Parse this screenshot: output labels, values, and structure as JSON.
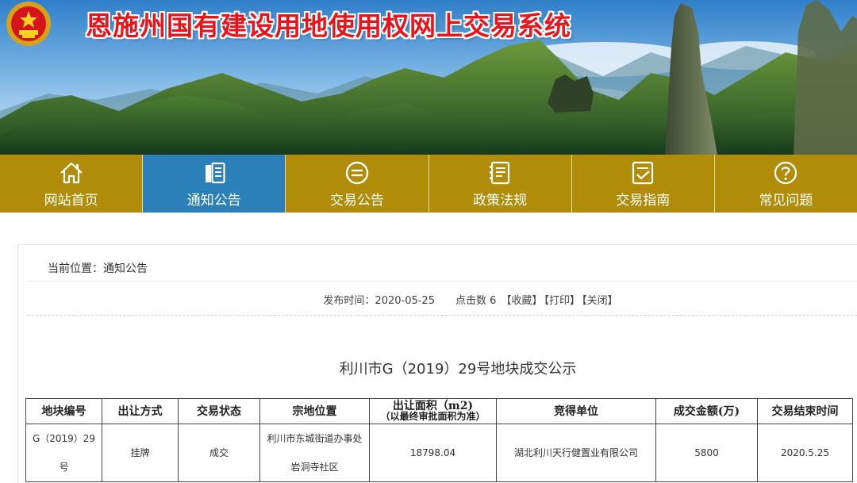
{
  "header": {
    "site_title": "恩施州国有建设用地使用权网上交易系统",
    "title_color": "#e8131b"
  },
  "nav": {
    "items": [
      {
        "label": "网站首页",
        "icon": "home-icon",
        "active": false
      },
      {
        "label": "通知公告",
        "icon": "notice-book-icon",
        "active": true
      },
      {
        "label": "交易公告",
        "icon": "trade-circle-icon",
        "active": false
      },
      {
        "label": "政策法规",
        "icon": "policy-book-icon",
        "active": false
      },
      {
        "label": "交易指南",
        "icon": "guide-check-icon",
        "active": false
      },
      {
        "label": "常见问题",
        "icon": "question-icon",
        "active": false
      }
    ],
    "bg_color": "#b08c09",
    "active_color": "#2b80b9"
  },
  "breadcrumb": {
    "text": "当前位置：通知公告"
  },
  "meta": {
    "publish_label": "发布时间：2020-05-25",
    "clicks_label": "点击数 6",
    "favorite": "【收藏】",
    "print": "【打印】",
    "close": "【关闭】"
  },
  "article": {
    "title": "利川市G（2019）29号地块成交公示"
  },
  "table": {
    "headers": [
      {
        "main": "地块编号",
        "sub": ""
      },
      {
        "main": "出让方式",
        "sub": ""
      },
      {
        "main": "交易状态",
        "sub": ""
      },
      {
        "main": "宗地位置",
        "sub": ""
      },
      {
        "main": "出让面积（m2)",
        "sub": "（以最终审批面积为准）"
      },
      {
        "main": "竞得单位",
        "sub": ""
      },
      {
        "main": "成交金额(万)",
        "sub": ""
      },
      {
        "main": "交易结束时间",
        "sub": ""
      }
    ],
    "rows": [
      [
        "G（2019）29号",
        "挂牌",
        "成交",
        "利川市东城街道办事处岩洞寺社区",
        "18798.04",
        "湖北利川天行健置业有限公司",
        "5800",
        "2020.5.25"
      ]
    ]
  }
}
